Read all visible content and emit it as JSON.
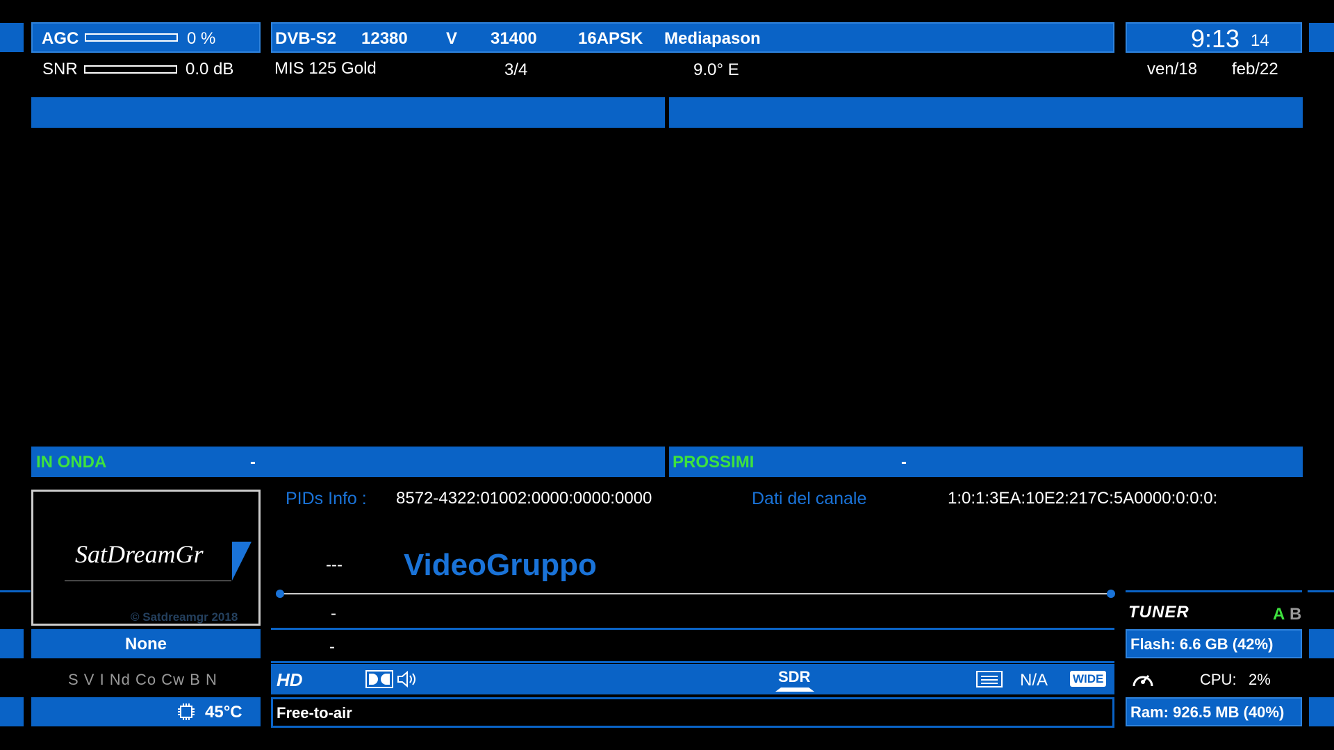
{
  "signal": {
    "agc_label": "AGC",
    "agc_value": "0 %",
    "agc_level": 0,
    "snr_label": "SNR",
    "snr_value": "0.0 dB",
    "snr_level": 0
  },
  "transponder": {
    "system": "DVB-S2",
    "frequency": "12380",
    "polarization": "V",
    "symbol_rate": "31400",
    "modulation": "16APSK",
    "provider": "Mediapason",
    "stream": "MIS 125 Gold",
    "fec": "3/4",
    "orbital": "9.0° E"
  },
  "clock": {
    "time": "9:13",
    "seconds": "14",
    "day": "ven/18",
    "date": "feb/22"
  },
  "epg": {
    "now_label": "IN ONDA",
    "now_title": "-",
    "next_label": "PROSSIMI",
    "next_title": "-"
  },
  "logo": {
    "text": "SatDreamGr",
    "copyright": "© Satdreamgr 2018"
  },
  "pids": {
    "label": "PIDs Info :",
    "value": "8572-4322:01002:0000:0000:0000",
    "channel_label": "Dati del canale",
    "channel_value": "1:0:1:3EA:10E2:217C:5A0000:0:0:0:"
  },
  "channel": {
    "number": "---",
    "name": "VideoGruppo"
  },
  "events": {
    "line1": "-",
    "line2": "-"
  },
  "crypt": {
    "value": "None",
    "systems": "S V I Nd Co Cw B N"
  },
  "av": {
    "hd": "HD",
    "sdr": "SDR",
    "aspect": "N/A",
    "wide": "WIDE"
  },
  "temp": {
    "value": "45°C"
  },
  "caid": {
    "value": "Free-to-air"
  },
  "tuner": {
    "label": "TUNER",
    "a": "A",
    "b": "B"
  },
  "system": {
    "flash": "Flash: 6.6 GB (42%)",
    "cpu_label": "CPU:",
    "cpu_value": "2%",
    "ram": "Ram: 926.5 MB (40%)"
  },
  "colors": {
    "accent": "#0a63c6",
    "active_tuner": "#3ee23e",
    "channel_name": "#1a73d8"
  }
}
